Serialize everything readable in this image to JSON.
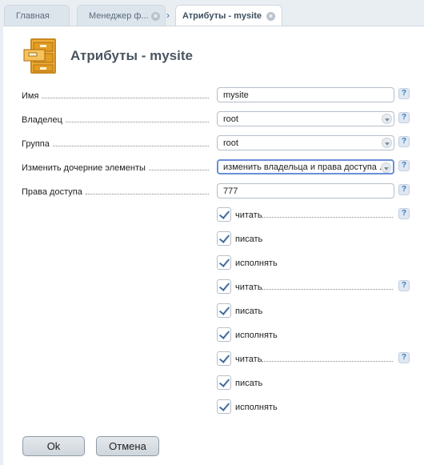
{
  "tabs": [
    {
      "label": "Главная"
    },
    {
      "label": "Менеджер ф..."
    },
    {
      "label": "Атрибуты - mysite"
    }
  ],
  "page": {
    "title": "Атрибуты - mysite"
  },
  "form": {
    "name": {
      "label": "Имя",
      "value": "mysite"
    },
    "owner": {
      "label": "Владелец",
      "value": "root"
    },
    "group": {
      "label": "Группа",
      "value": "root"
    },
    "recursive": {
      "label": "Изменить дочерние элементы",
      "value": "изменить владельца и права доступа ..."
    },
    "permissions": {
      "label": "Права доступа",
      "value": "777"
    },
    "help_text": "?",
    "perm_groups": [
      {
        "items": [
          {
            "label": "читать",
            "checked": true
          },
          {
            "label": "писать",
            "checked": true
          },
          {
            "label": "исполнять",
            "checked": true
          }
        ]
      },
      {
        "items": [
          {
            "label": "читать",
            "checked": true
          },
          {
            "label": "писать",
            "checked": true
          },
          {
            "label": "исполнять",
            "checked": true
          }
        ]
      },
      {
        "items": [
          {
            "label": "читать",
            "checked": true
          },
          {
            "label": "писать",
            "checked": true
          },
          {
            "label": "исполнять",
            "checked": true
          }
        ]
      }
    ]
  },
  "buttons": {
    "ok": "Ok",
    "cancel": "Отмена"
  },
  "colors": {
    "accent": "#3a79c4",
    "focus": "#6b8fd8",
    "title": "#4a5560"
  }
}
